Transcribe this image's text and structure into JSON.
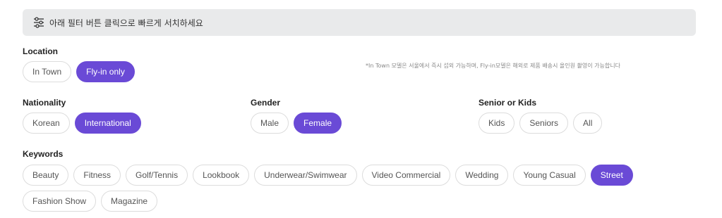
{
  "banner": {
    "text": "아래 필터 버튼 클릭으로 빠르게 서치하세요",
    "icon": "sliders-icon"
  },
  "location": {
    "label": "Location",
    "options": [
      {
        "label": "In Town",
        "selected": false
      },
      {
        "label": "Fly-in only",
        "selected": true
      }
    ],
    "note": "*In Town 모델은 서울에서 즉시 섭외 가능하며, Fly-in모델은 해외로 제품 배송시 올인원 촬영이 가능합니다"
  },
  "nationality": {
    "label": "Nationality",
    "options": [
      {
        "label": "Korean",
        "selected": false
      },
      {
        "label": "International",
        "selected": true
      }
    ]
  },
  "gender": {
    "label": "Gender",
    "options": [
      {
        "label": "Male",
        "selected": false
      },
      {
        "label": "Female",
        "selected": true
      }
    ]
  },
  "senior_kids": {
    "label": "Senior or Kids",
    "options": [
      {
        "label": "Kids",
        "selected": false
      },
      {
        "label": "Seniors",
        "selected": false
      },
      {
        "label": "All",
        "selected": false
      }
    ]
  },
  "keywords": {
    "label": "Keywords",
    "options": [
      {
        "label": "Beauty",
        "selected": false
      },
      {
        "label": "Fitness",
        "selected": false
      },
      {
        "label": "Golf/Tennis",
        "selected": false
      },
      {
        "label": "Lookbook",
        "selected": false
      },
      {
        "label": "Underwear/Swimwear",
        "selected": false
      },
      {
        "label": "Video Commercial",
        "selected": false
      },
      {
        "label": "Wedding",
        "selected": false
      },
      {
        "label": "Young Casual",
        "selected": false
      },
      {
        "label": "Street",
        "selected": true
      },
      {
        "label": "Fashion Show",
        "selected": false
      },
      {
        "label": "Magazine",
        "selected": false
      }
    ]
  },
  "colors": {
    "accent": "#6a4ad6",
    "banner_bg": "#e9eaeb",
    "chip_border": "#dcdcdc"
  }
}
